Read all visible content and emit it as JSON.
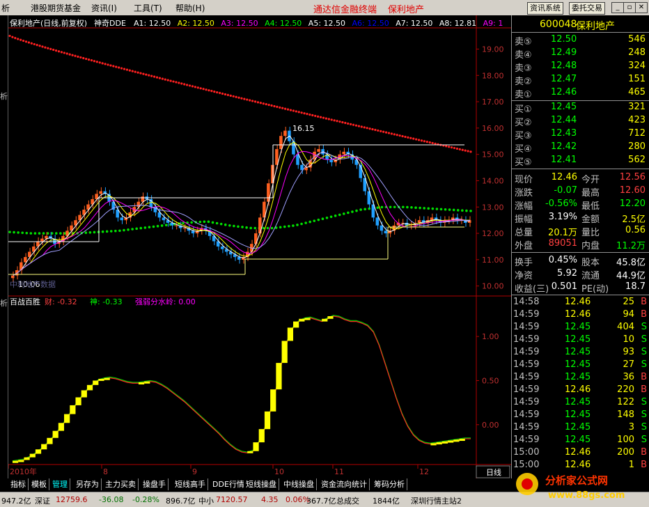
{
  "menu": {
    "items": [
      "析",
      "港股期货基金",
      "资讯(I)",
      "工具(T)",
      "帮助(H)"
    ],
    "promo1": "通达信金融终端",
    "promo2": "保利地产",
    "btn_info": "资讯系统",
    "btn_trade": "委托交易"
  },
  "left_strip": [
    "析",
    "析"
  ],
  "chart_data": {
    "type": "candlestick",
    "title": "保利地产(日线,前复权)",
    "indicator_label": "神奇DDE",
    "ma": [
      {
        "name": "A1",
        "value": "12.50",
        "color": "#ffffff"
      },
      {
        "name": "A2",
        "value": "12.50",
        "color": "#ffff00"
      },
      {
        "name": "A3",
        "value": "12.50",
        "color": "#ff00ff"
      },
      {
        "name": "A4",
        "value": "12.50",
        "color": "#00ff00"
      },
      {
        "name": "A5",
        "value": "12.50",
        "color": "#ffffff"
      },
      {
        "name": "A6",
        "value": "12.50",
        "color": "#0000ff"
      },
      {
        "name": "A7",
        "value": "12.50",
        "color": "#ffffff"
      },
      {
        "name": "A8",
        "value": "12.81",
        "color": "#ffffff"
      },
      {
        "name": "A9",
        "value": "1",
        "color": "#ff00ff"
      }
    ],
    "y_ticks": [
      "19.00",
      "18.00",
      "17.00",
      "16.00",
      "15.00",
      "14.00",
      "13.00",
      "12.00",
      "11.00",
      "10.00"
    ],
    "ylim": [
      9.7,
      19.7
    ],
    "high_label": "16.15",
    "low_label": "10.06",
    "watermark": "中利地产数据",
    "closes": [
      10.4,
      10.6,
      10.9,
      11.1,
      11.3,
      11.5,
      11.7,
      11.8,
      11.9,
      11.8,
      11.6,
      11.7,
      11.9,
      12.1,
      12.3,
      12.5,
      12.7,
      12.9,
      13.1,
      13.3,
      13.5,
      13.6,
      13.5,
      13.2,
      12.9,
      12.6,
      12.5,
      12.6,
      12.8,
      13.0,
      13.2,
      13.4,
      13.3,
      13.0,
      12.8,
      12.6,
      12.5,
      12.4,
      12.3,
      12.3,
      12.2,
      12.2,
      12.1,
      12.0,
      12.1,
      12.2,
      12.1,
      11.9,
      11.7,
      11.5,
      11.4,
      11.3,
      11.2,
      11.1,
      11.0,
      11.1,
      11.3,
      11.6,
      12.0,
      12.6,
      13.2,
      13.9,
      14.6,
      15.2,
      15.7,
      15.9,
      15.5,
      15.0,
      14.6,
      14.4,
      14.5,
      14.8,
      15.1,
      15.2,
      15.0,
      14.8,
      14.7,
      14.8,
      15.0,
      15.1,
      15.0,
      14.8,
      14.6,
      14.1,
      13.6,
      13.1,
      12.6,
      12.3,
      12.1,
      12.0,
      12.1,
      12.3,
      12.4,
      12.4,
      12.3,
      12.3,
      12.4,
      12.5,
      12.4,
      12.5,
      12.6,
      12.5,
      12.4,
      12.5,
      12.5,
      12.6,
      12.5,
      12.5,
      12.4,
      12.5
    ],
    "ma_red_start": 19.5,
    "ma_red_end": 15.1,
    "ma_green": [
      12.05,
      12.0,
      12.0,
      12.0,
      12.05,
      12.1,
      12.2,
      12.3,
      12.4,
      12.45,
      12.3,
      12.2,
      12.2,
      12.3,
      12.5,
      12.7,
      12.9,
      13.0,
      13.0,
      12.95,
      12.9,
      12.85
    ],
    "x_labels": [
      "2010年",
      "8",
      "9",
      "10",
      "11",
      "12"
    ],
    "sub_title": "百战百胜",
    "sub_items": [
      {
        "label": "财:",
        "value": "-0.32",
        "color": "#ff4040"
      },
      {
        "label": "神:",
        "value": "-0.33",
        "color": "#00ff00"
      },
      {
        "label": "强弱分水岭:",
        "value": "0.00",
        "color": "#ff00ff"
      }
    ],
    "sub_y_ticks": [
      "1.00",
      "0.50",
      "0.00"
    ],
    "sub_ylim": [
      -0.42,
      1.38
    ],
    "sub_values": [
      -0.42,
      -0.41,
      -0.4,
      -0.37,
      -0.33,
      -0.28,
      -0.22,
      -0.15,
      -0.07,
      0.02,
      0.12,
      0.22,
      0.31,
      0.39,
      0.45,
      0.5,
      0.52,
      0.53,
      0.52,
      0.5,
      0.48,
      0.47,
      0.47,
      0.48,
      0.49,
      0.48,
      0.45,
      0.41,
      0.36,
      0.31,
      0.26,
      0.2,
      0.14,
      0.08,
      0.02,
      -0.04,
      -0.1,
      -0.17,
      -0.23,
      -0.28,
      -0.31,
      -0.32,
      -0.3,
      -0.2,
      -0.05,
      0.15,
      0.4,
      0.7,
      0.95,
      1.1,
      1.17,
      1.2,
      1.21,
      1.19,
      1.17,
      1.2,
      1.23,
      1.22,
      1.19,
      1.17,
      1.17,
      1.15,
      1.12,
      1.05,
      0.9,
      0.7,
      0.5,
      0.3,
      0.12,
      -0.02,
      -0.12,
      -0.18,
      -0.21,
      -0.22,
      -0.21,
      -0.2,
      -0.19,
      -0.18,
      -0.17,
      -0.16,
      -0.16
    ],
    "period_label": "日线"
  },
  "quote": {
    "code": "600048",
    "name": "保利地产",
    "asks": [
      {
        "label": "卖⑤",
        "price": "12.50",
        "vol": "546"
      },
      {
        "label": "卖④",
        "price": "12.49",
        "vol": "248"
      },
      {
        "label": "卖③",
        "price": "12.48",
        "vol": "324"
      },
      {
        "label": "卖②",
        "price": "12.47",
        "vol": "151"
      },
      {
        "label": "卖①",
        "price": "12.46",
        "vol": "465"
      }
    ],
    "bids": [
      {
        "label": "买①",
        "price": "12.45",
        "vol": "321"
      },
      {
        "label": "买②",
        "price": "12.44",
        "vol": "423"
      },
      {
        "label": "买③",
        "price": "12.43",
        "vol": "712"
      },
      {
        "label": "买④",
        "price": "12.42",
        "vol": "280"
      },
      {
        "label": "买⑤",
        "price": "12.41",
        "vol": "562"
      }
    ],
    "stats": [
      {
        "l1": "现价",
        "v1": "12.46",
        "c1": "#ffff00",
        "l2": "今开",
        "v2": "12.56",
        "c2": "#ff4040"
      },
      {
        "l1": "涨跌",
        "v1": "-0.07",
        "c1": "#00ff00",
        "l2": "最高",
        "v2": "12.60",
        "c2": "#ff4040"
      },
      {
        "l1": "涨幅",
        "v1": "-0.56%",
        "c1": "#00ff00",
        "l2": "最低",
        "v2": "12.20",
        "c2": "#00ff00"
      },
      {
        "l1": "振幅",
        "v1": "3.19%",
        "c1": "#ffffff",
        "l2": "金额",
        "v2": "2.5亿",
        "c2": "#ffff00"
      },
      {
        "l1": "总量",
        "v1": "20.1万",
        "c1": "#ffff00",
        "l2": "量比",
        "v2": "0.56",
        "c2": "#ffff00"
      },
      {
        "l1": "外盘",
        "v1": "89051",
        "c1": "#ff4040",
        "l2": "内盘",
        "v2": "11.2万",
        "c2": "#00ff00"
      }
    ],
    "stats2": [
      {
        "l1": "换手",
        "v1": "0.45%",
        "l2": "股本",
        "v2": "45.8亿"
      },
      {
        "l1": "净资",
        "v1": "5.92",
        "l2": "流通",
        "v2": "44.9亿"
      },
      {
        "l1": "收益(三)",
        "v1": "0.501",
        "l2": "PE(动)",
        "v2": "18.7"
      }
    ],
    "ticks": [
      {
        "t": "14:58",
        "p": "12.46",
        "v": "25",
        "s": "B"
      },
      {
        "t": "14:59",
        "p": "12.46",
        "v": "94",
        "s": "B"
      },
      {
        "t": "14:59",
        "p": "12.45",
        "v": "404",
        "s": "S"
      },
      {
        "t": "14:59",
        "p": "12.45",
        "v": "10",
        "s": "S"
      },
      {
        "t": "14:59",
        "p": "12.45",
        "v": "93",
        "s": "S"
      },
      {
        "t": "14:59",
        "p": "12.45",
        "v": "27",
        "s": "S"
      },
      {
        "t": "14:59",
        "p": "12.45",
        "v": "36",
        "s": "B"
      },
      {
        "t": "14:59",
        "p": "12.46",
        "v": "220",
        "s": "B"
      },
      {
        "t": "14:59",
        "p": "12.45",
        "v": "122",
        "s": "S"
      },
      {
        "t": "14:59",
        "p": "12.45",
        "v": "148",
        "s": "S"
      },
      {
        "t": "14:59",
        "p": "12.45",
        "v": "3",
        "s": "S"
      },
      {
        "t": "14:59",
        "p": "12.45",
        "v": "100",
        "s": "S"
      },
      {
        "t": "15:00",
        "p": "12.46",
        "v": "200",
        "s": "B"
      },
      {
        "t": "15:00",
        "p": "12.46",
        "v": "1",
        "s": "B"
      }
    ]
  },
  "tabs": [
    "指标",
    "模板",
    "管理",
    "另存为",
    "主力买卖",
    "操盘手",
    "短线高手",
    "DDE行情",
    "短线操盘",
    "中线操盘",
    "资金流向统计",
    "筹码分析"
  ],
  "status": {
    "s1": "947.2亿",
    "s2": "深证",
    "s3": "12759.6",
    "s4": "-36.08",
    "s5": "-0.28%",
    "s6": "896.7亿",
    "s7": "中小",
    "s8": "7120.57",
    "s9": "4.35",
    "s10": "0.06%",
    "s11": "367.7亿",
    "s12": "总成交",
    "s13": "1844亿",
    "s14": "深圳行情主站2"
  },
  "watermark": {
    "site": "分析家公式网",
    "url": "www.88gs.com"
  }
}
